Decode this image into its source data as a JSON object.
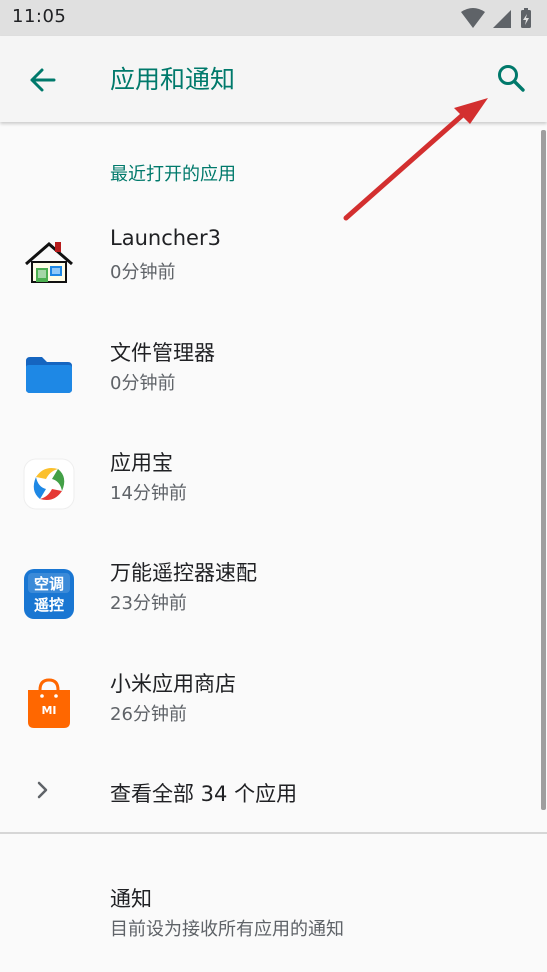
{
  "status_bar": {
    "time": "11:05"
  },
  "app_bar": {
    "title": "应用和通知"
  },
  "recent_apps": {
    "header": "最近打开的应用",
    "items": [
      {
        "name": "Launcher3",
        "time": "0分钟前",
        "icon": "launcher-house-icon"
      },
      {
        "name": "文件管理器",
        "time": "0分钟前",
        "icon": "folder-icon"
      },
      {
        "name": "应用宝",
        "time": "14分钟前",
        "icon": "yingyongbao-icon"
      },
      {
        "name": "万能遥控器速配",
        "time": "23分钟前",
        "icon": "remote-control-icon"
      },
      {
        "name": "小米应用商店",
        "time": "26分钟前",
        "icon": "mi-store-icon"
      }
    ],
    "see_all": "查看全部 34 个应用"
  },
  "notifications": {
    "title": "通知",
    "subtitle": "目前设为接收所有应用的通知"
  },
  "remote_icon_text": {
    "line1": "空调",
    "line2": "遥控"
  },
  "mi_icon_text": "MI",
  "colors": {
    "accent": "#00796b",
    "annotation_arrow": "#d32f2f",
    "folder": "#1e88e5",
    "mi_orange": "#ff6700"
  }
}
